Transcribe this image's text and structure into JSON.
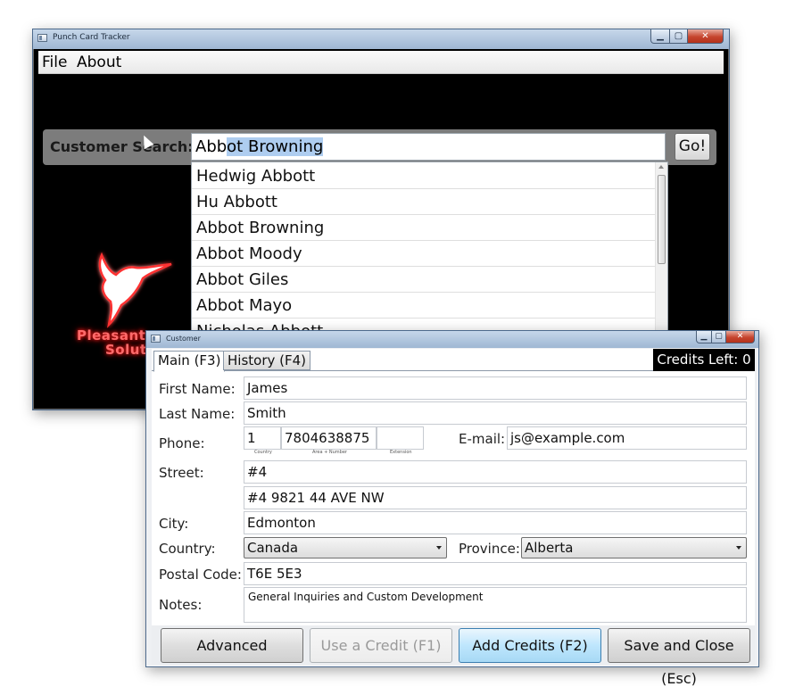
{
  "main_window": {
    "title": "Punch Card Tracker",
    "menu": {
      "file": "File",
      "about": "About"
    },
    "search": {
      "label": "Customer Search:",
      "typed": "Abb",
      "autocomplete": "ot Browning",
      "go_label": "Go!"
    },
    "results": [
      "Hedwig Abbott",
      "Hu Abbott",
      "Abbot Browning",
      "Abbot Moody",
      "Abbot Giles",
      "Abbot Mayo",
      "Nicholas Abbott"
    ],
    "brand": {
      "line1": "Pleasant",
      "line2": "Soluti"
    },
    "colors": {
      "brand_glow": "#ff2020",
      "selection": "#aecdf0"
    }
  },
  "customer_window": {
    "title": "Customer",
    "tabs": {
      "main": "Main (F3)",
      "history": "History (F4)"
    },
    "credits": "Credits Left: 0",
    "labels": {
      "first_name": "First Name:",
      "last_name": "Last Name:",
      "phone": "Phone:",
      "email": "E-mail:",
      "street": "Street:",
      "city": "City:",
      "country": "Country:",
      "province": "Province:",
      "postal": "Postal Code:",
      "notes": "Notes:",
      "phone_country_caption": "Country",
      "phone_number_caption": "Area + Number",
      "phone_ext_caption": "Extension"
    },
    "values": {
      "first_name": "James",
      "last_name": "Smith",
      "phone_country": "1",
      "phone_number": "7804638875",
      "phone_ext": "",
      "email": "js@example.com",
      "street1": "#4",
      "street2": "#4 9821 44 AVE NW",
      "city": "Edmonton",
      "country": "Canada",
      "province": "Alberta",
      "postal": "T6E 5E3",
      "notes": "General Inquiries and Custom Development"
    },
    "buttons": {
      "advanced": "Advanced",
      "use_credit": "Use a Credit (F1)",
      "add_credits": "Add Credits (F2)",
      "save_close": "Save and Close (Esc)"
    }
  }
}
